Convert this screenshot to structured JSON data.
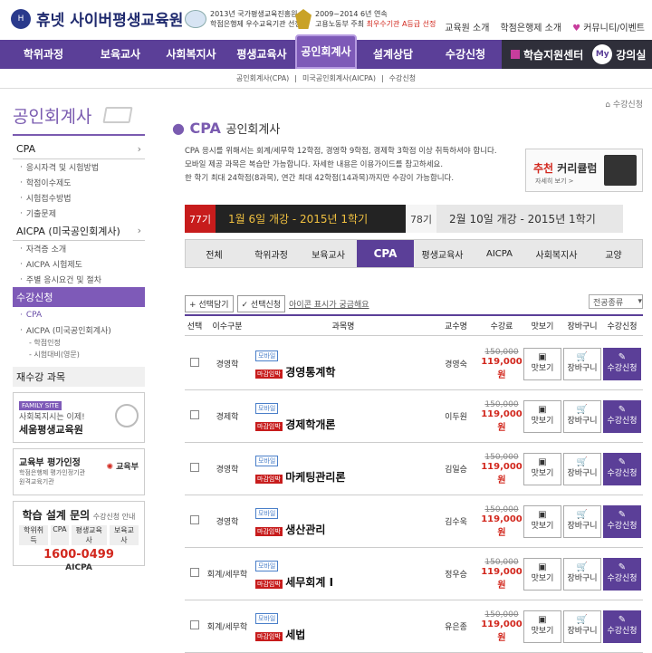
{
  "header": {
    "logo": {
      "brand": "휴넷",
      "name": "사이버평생교육원"
    },
    "award1": {
      "line1": "2013년 국가평생교육진흥원",
      "line2": "학점은행제 우수교육기관 선정"
    },
    "award2": {
      "line1": "2009~2014 6년 연속",
      "line2a": "고용노동부 주최 ",
      "line2b": "최우수기관 A등급 선정"
    },
    "links": [
      "교육원 소개",
      "학점은행제 소개",
      "커뮤니티/이벤트"
    ]
  },
  "nav": {
    "items": [
      "학위과정",
      "보육교사",
      "사회복지사",
      "평생교육사",
      "설계상담",
      "수강신청"
    ],
    "active": "공인회계사",
    "center": "학습지원센터",
    "my_label": "My",
    "my_room": "강의실"
  },
  "subnav": [
    "공인회계사(CPA)",
    "미국공인회계사(AICPA)",
    "수강신청"
  ],
  "sidebar": {
    "title": "공인회계사",
    "cpa": {
      "label": "CPA",
      "subs": [
        "응시자격 및 시험방법",
        "학점이수제도",
        "시험접수방법",
        "기출문제"
      ]
    },
    "aicpa": {
      "label": "AICPA (미국공인회계사)",
      "subs": [
        "자격증 소개",
        "AICPA 시험제도",
        "주별 응시요건 및 절차"
      ]
    },
    "register": {
      "label": "수강신청",
      "subs": [
        "CPA",
        "AICPA (미국공인회계사)"
      ],
      "notes": [
        "- 학점인정",
        "- 시험대비(영문)"
      ]
    },
    "reregister": "재수강 과목",
    "family": {
      "badge": "FAMILY SITE",
      "line1": "사회복지시는 이제!",
      "line2": "세움평생교육원"
    },
    "eval": {
      "title": "교육부 평가인정",
      "line1": "학점은행제 평가인정기관",
      "line2": "원격교육기관",
      "ministry": "교육부"
    },
    "consult": {
      "title": "학습 설계 문의",
      "sub": "수강신청 안내",
      "tags": [
        "학위취득",
        "CPA",
        "평생교육사",
        "보육교사"
      ],
      "phone": "1600-0499",
      "footer": "AICPA"
    }
  },
  "main": {
    "crumb": "수강신청",
    "title_en": "CPA",
    "title_ko": "공인회계사",
    "notes": [
      "CPA 응시를 위해서는 회계/세무학 12학점, 경영학 9학점, 경제학 3학점 이상 취득하셔야 합니다.",
      "모바일 제공 과목은 복습만 가능합니다. 자세한 내용은 이용가이드를 참고하세요.",
      "한 학기 최대 24학점(8과목), 연간 최대 42학점(14과목)까지만 수강이 가능합니다."
    ],
    "curriculum": {
      "label1": "추천",
      "label2": "커리큘럼",
      "more": "자세히 보기 >"
    },
    "round1": {
      "tag": "77기",
      "text": "1월 6일 개강 - 2015년 1학기"
    },
    "round2": {
      "tag": "78기",
      "text": "2월 10일 개강 - 2015년 1학기"
    },
    "tabs": [
      "전체",
      "학위과정",
      "보육교사",
      "CPA",
      "평생교육사",
      "AICPA",
      "사회복지사",
      "교양"
    ],
    "active_tab": "CPA",
    "tools": {
      "select": "+ 선택담기",
      "apply": "✓ 선택신청",
      "link": "아이콘 표시가 궁금해요"
    },
    "kind_select": "전공종류",
    "columns": [
      "선택",
      "이수구분",
      "과목명",
      "교수명",
      "수강료",
      "맛보기",
      "장바구니",
      "수강신청"
    ],
    "buttons": {
      "preview": "맛보기",
      "cart": "장바구니",
      "apply": "수강신청"
    },
    "mobile_label": "모바일",
    "badge_label": "마감임박",
    "rows": [
      {
        "type": "경영학",
        "name": "경영통계학",
        "prof": "경영숙",
        "old": "150,000",
        "price": "119,000 원"
      },
      {
        "type": "경제학",
        "name": "경제학개론",
        "prof": "이두원",
        "old": "150,000",
        "price": "119,000 원"
      },
      {
        "type": "경영학",
        "name": "마케팅관리론",
        "prof": "김일승",
        "old": "150,000",
        "price": "119,000 원"
      },
      {
        "type": "경영학",
        "name": "생산관리",
        "prof": "김수욱",
        "old": "150,000",
        "price": "119,000 원"
      },
      {
        "type": "회계/세무학",
        "name": "세무회계 I",
        "prof": "정우승",
        "old": "150,000",
        "price": "119,000 원"
      },
      {
        "type": "회계/세무학",
        "name": "세법",
        "prof": "유은종",
        "old": "150,000",
        "price": "119,000 원"
      }
    ]
  }
}
